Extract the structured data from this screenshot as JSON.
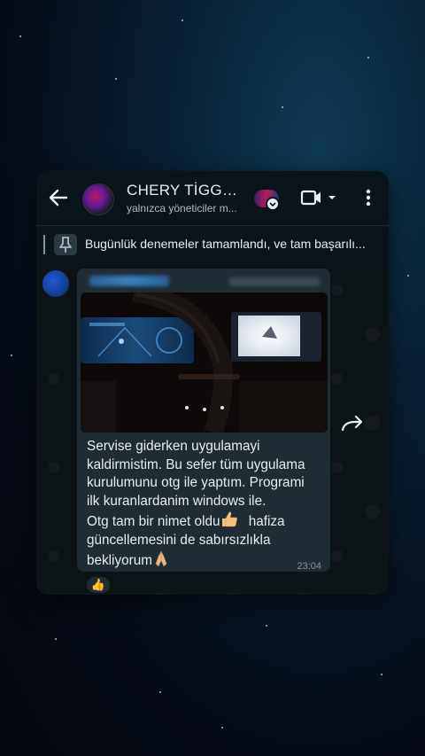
{
  "chat": {
    "title": "CHERY TİGGO...",
    "subtitle": "yalnızca yöneticiler m...",
    "pinned_message": "Bugünlük denemeler tamamlandı, ve tam başarılı..."
  },
  "message": {
    "lines": [
      "Servise giderken uygulamayi",
      "kaldirmistim. Bu sefer tüm uygulama",
      "kurulumunu otg ile yaptım. Programi",
      "ilk kuranlardanim windows ile.",
      "Otg tam bir nimet oldu",
      "güncellemesini de sabırsızlıkla",
      "bekliyorum"
    ],
    "line5_tail": "hafiza",
    "time": "23:04",
    "reaction": "👍"
  },
  "icons": {
    "back": "arrow-left-icon",
    "video": "video-call-icon",
    "more": "more-vert-icon",
    "pin": "pin-icon",
    "forward": "forward-icon"
  },
  "colors": {
    "header_bg": "#0b141a",
    "bubble_bg": "#1f2c33",
    "text_primary": "#e9edef",
    "text_secondary": "#8696a0"
  }
}
